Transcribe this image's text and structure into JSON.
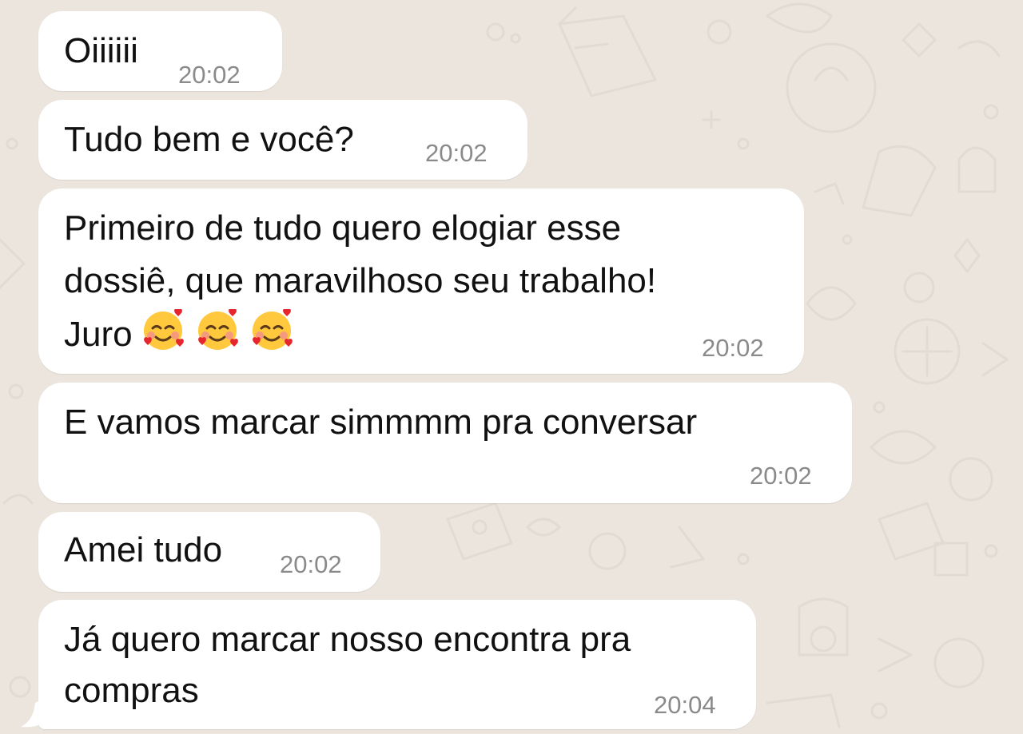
{
  "messages": [
    {
      "text": "Oiiiiii",
      "time": "20:02"
    },
    {
      "text": "Tudo bem e você?",
      "time": "20:02"
    },
    {
      "lines": [
        "Primeiro de tudo quero elogiar esse",
        "dossiê, que maravilhoso seu trabalho!",
        "Juro"
      ],
      "emoji": [
        "smiling-face-with-hearts-icon",
        "smiling-face-with-hearts-icon",
        "smiling-face-with-hearts-icon"
      ],
      "time": "20:02"
    },
    {
      "text": "E vamos marcar simmmm pra conversar",
      "time": "20:02"
    },
    {
      "text": "Amei tudo",
      "time": "20:02"
    },
    {
      "lines": [
        "Já quero marcar nosso encontra pra",
        "compras"
      ],
      "time": "20:04"
    }
  ],
  "theme": {
    "wallpaper": "#ebe5dd",
    "bubble": "#ffffff",
    "text": "#111111",
    "timestamp": "#8a8a8a"
  }
}
